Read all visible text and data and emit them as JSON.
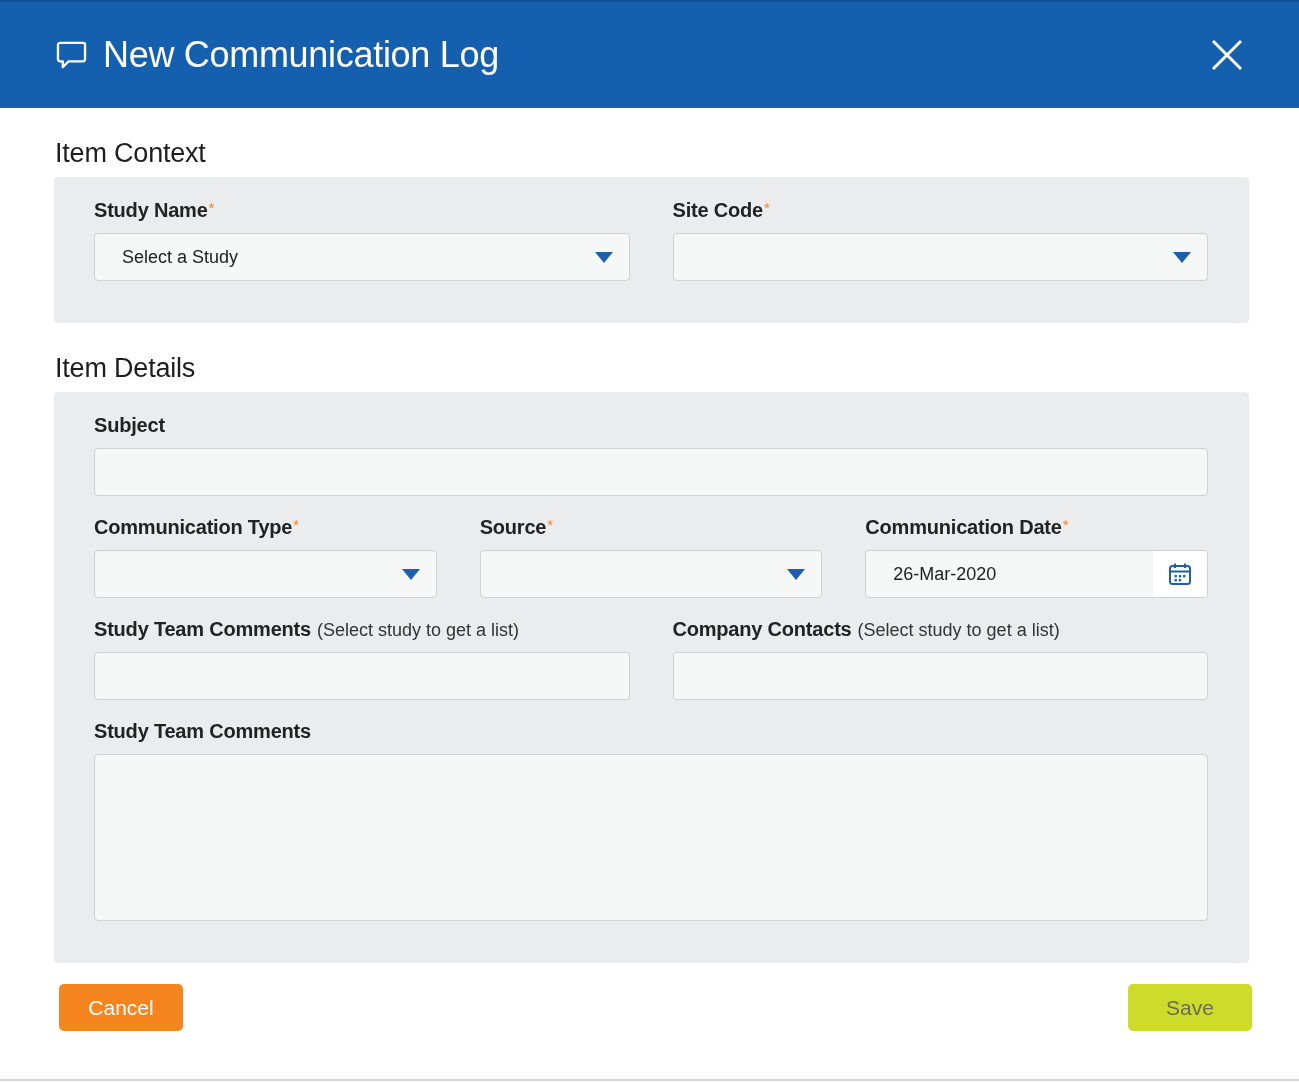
{
  "dialog": {
    "title": "New Communication Log"
  },
  "sections": [
    {
      "title": "Item Context",
      "field_groups": [
        {
          "fields": [
            {
              "label": "Study Name",
              "mark": "*",
              "kind": "select",
              "value": "Select a Study"
            },
            {
              "label": "Site Code",
              "mark": "*",
              "kind": "select"
            }
          ]
        }
      ]
    },
    {
      "title": "Item Details",
      "field_groups": [
        {
          "fields": [
            {
              "label": "Subject",
              "kind": "text"
            }
          ]
        },
        {
          "fields": [
            {
              "label": "Communication Type",
              "mark": "*",
              "kind": "select"
            },
            {
              "label": "Source",
              "mark": "*",
              "kind": "select"
            },
            {
              "label": "Communication Date",
              "mark": "*",
              "kind": "date",
              "value": "26-Mar-2020"
            }
          ]
        },
        {
          "fields": [
            {
              "label": "Study Team Comments",
              "hint": "(Select study to get a list)",
              "kind": "text"
            },
            {
              "label": "Company Contacts",
              "hint": "(Select study to get a list)",
              "kind": "text"
            }
          ]
        },
        {
          "fields": [
            {
              "label": "Study Team Comments",
              "kind": "textarea"
            }
          ]
        }
      ]
    }
  ],
  "buttons": [
    {
      "label": "Cancel",
      "kind": "cancel"
    },
    {
      "label": "Save",
      "kind": "save"
    }
  ]
}
